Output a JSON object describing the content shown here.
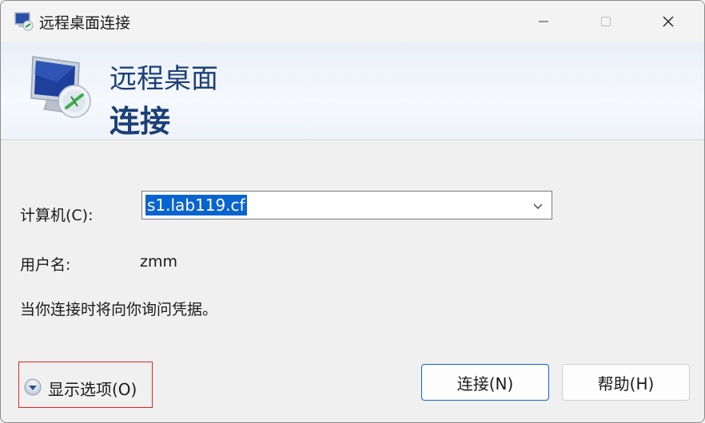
{
  "window": {
    "title": "远程桌面连接",
    "icon": "remote-desktop-icon",
    "controls": [
      "minimize-icon",
      "maximize-icon",
      "close-icon"
    ]
  },
  "banner": {
    "line1": "远程桌面",
    "line2": "连接",
    "icon": "remote-desktop-monitor-icon"
  },
  "form": {
    "computer_label": "计算机(C):",
    "computer_value": "s1.lab119.cf",
    "username_label": "用户名:",
    "username_value": "zmm",
    "credentials_note": "当你连接时将向你询问凭据。"
  },
  "footer": {
    "show_options_label": "显示选项(O)",
    "connect_label": "连接(N)",
    "help_label": "帮助(H)"
  },
  "colors": {
    "accent": "#0a64d0",
    "banner_text": "#1c3f78",
    "highlight_box": "#e0241c"
  }
}
